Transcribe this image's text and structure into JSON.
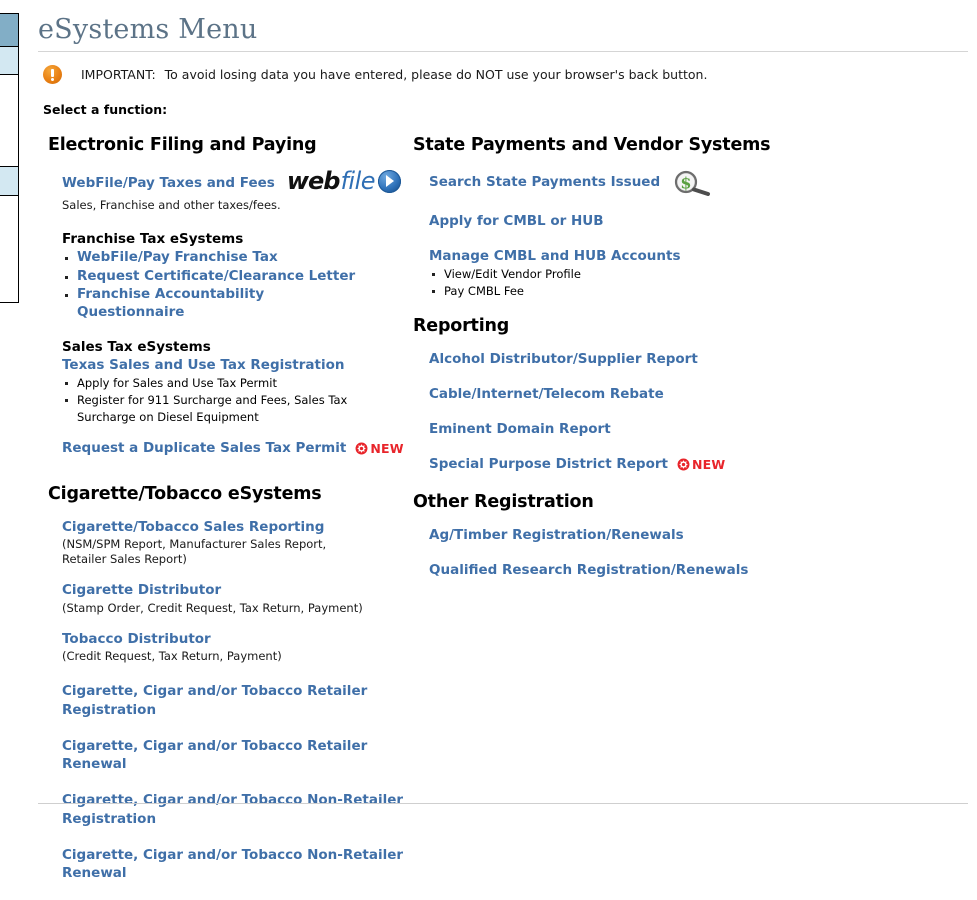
{
  "colors": {
    "title": "#5c7387",
    "link": "#3f6fa8",
    "new_badge": "#e8252b",
    "alert": "#e98013",
    "sidebar_active": "#82aec6",
    "sidebar_light": "#d3e8f2",
    "money_green": "#5aa041"
  },
  "header": {
    "title": "eSystems Menu"
  },
  "notice": {
    "icon": "alert-exclamation-icon",
    "label": "IMPORTANT:",
    "text": "To avoid losing data you have entered, please do NOT use your browser's back button."
  },
  "instruction": "Select a function:",
  "left_column": {
    "sections": [
      {
        "heading": "Electronic Filing and Paying",
        "webfile_link": "WebFile/Pay Taxes and Fees",
        "webfile_logo": {
          "part1": "web",
          "part2": "file",
          "arrow_icon": "play-arrow-circle-icon"
        },
        "webfile_subtext": "Sales, Franchise and other taxes/fees.",
        "franchise_heading": "Franchise Tax eSystems",
        "franchise_links": [
          "WebFile/Pay Franchise Tax",
          "Request Certificate/Clearance Letter",
          "Franchise Accountability Questionnaire"
        ],
        "sales_heading": "Sales Tax eSystems",
        "sales_main_link": "Texas Sales and Use Tax Registration",
        "sales_bullets": [
          "Apply for Sales and Use Tax Permit",
          "Register for 911 Surcharge and Fees, Sales Tax Surcharge on Diesel Equipment"
        ],
        "duplicate_permit_link": "Request a Duplicate Sales Tax Permit",
        "duplicate_permit_badge": "NEW"
      },
      {
        "heading": "Cigarette/Tobacco eSystems",
        "items": [
          {
            "link": "Cigarette/Tobacco Sales Reporting",
            "subtext": "(NSM/SPM Report, Manufacturer Sales Report, Retailer Sales Report)"
          },
          {
            "link": "Cigarette Distributor",
            "subtext": "(Stamp Order, Credit Request, Tax Return, Payment)"
          },
          {
            "link": "Tobacco Distributor",
            "subtext": "(Credit Request, Tax Return, Payment)"
          },
          {
            "link": "Cigarette, Cigar and/or Tobacco Retailer Registration",
            "subtext": ""
          },
          {
            "link": "Cigarette, Cigar and/or Tobacco Retailer Renewal",
            "subtext": ""
          },
          {
            "link": "Cigarette, Cigar and/or Tobacco Non-Retailer Registration",
            "subtext": ""
          },
          {
            "link": "Cigarette, Cigar and/or Tobacco Non-Retailer Renewal",
            "subtext": ""
          }
        ]
      }
    ]
  },
  "right_column": {
    "state_payments": {
      "heading": "State Payments and Vendor Systems",
      "search_link": "Search State Payments Issued",
      "search_icon": "dollar-magnifier-icon",
      "apply_link": "Apply for CMBL or HUB",
      "manage_link": "Manage CMBL and HUB Accounts",
      "manage_bullets": [
        "View/Edit Vendor Profile",
        "Pay CMBL Fee"
      ]
    },
    "reporting": {
      "heading": "Reporting",
      "links": [
        {
          "label": "Alcohol Distributor/Supplier Report",
          "badge": ""
        },
        {
          "label": "Cable/Internet/Telecom Rebate",
          "badge": ""
        },
        {
          "label": "Eminent Domain Report",
          "badge": ""
        },
        {
          "label": "Special Purpose District Report",
          "badge": "NEW"
        }
      ]
    },
    "other_registration": {
      "heading": "Other Registration",
      "links": [
        "Ag/Timber Registration/Renewals",
        "Qualified Research Registration/Renewals"
      ]
    }
  }
}
